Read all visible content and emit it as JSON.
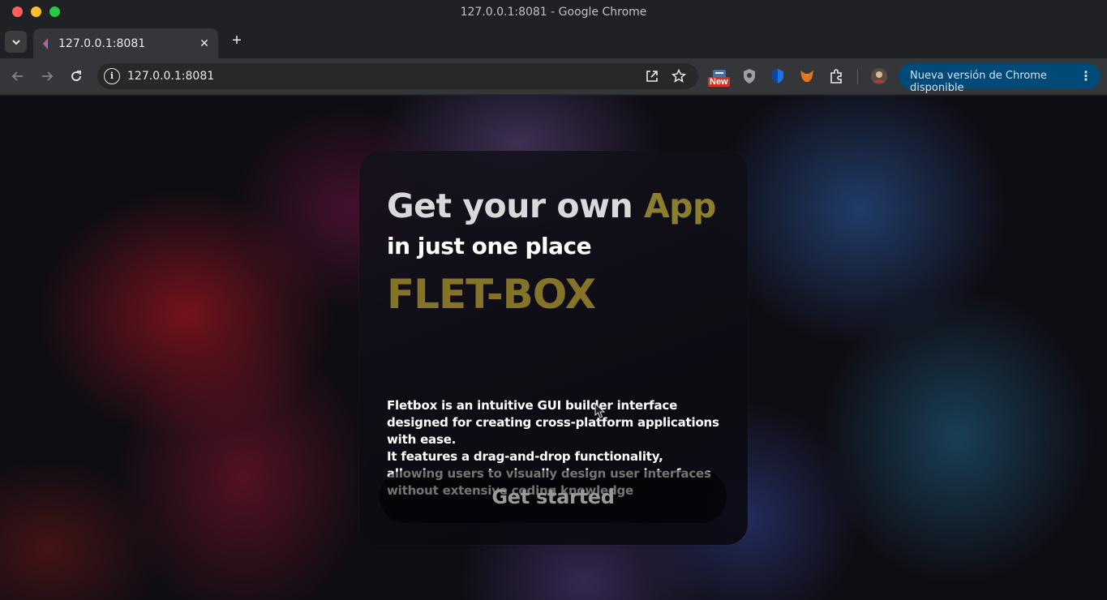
{
  "window": {
    "title": "127.0.0.1:8081 - Google Chrome"
  },
  "tab": {
    "title": "127.0.0.1:8081",
    "close_glyph": "✕",
    "new_tab_glyph": "+"
  },
  "toolbar": {
    "url": "127.0.0.1:8081",
    "extension_badge": "New",
    "update_button_label": "Nueva versión de Chrome disponible",
    "update_menu_glyph": "⋮"
  },
  "icons": {
    "back": "arrow-left-icon",
    "forward": "arrow-right-icon",
    "reload": "reload-icon",
    "site_info": "info-icon",
    "open_in_app": "open-external-icon",
    "bookmark": "star-icon",
    "extensions": "puzzle-icon"
  },
  "hero": {
    "headline_prefix": "Get your own",
    "headline_accent": "App",
    "subheadline": "in just one place",
    "brand": "FLET-BOX",
    "description_1": "Fletbox is an intuitive GUI builder interface designed for creating cross-platform applications with ease.",
    "description_2": "It features a drag-and-drop functionality, allowing users to visually design user interfaces without extensive coding knowledge",
    "cta_label": "Get started"
  },
  "colors": {
    "accent_gold": "#8b7f2e",
    "brand_gold": "#857428",
    "update_button": "#004a77"
  }
}
